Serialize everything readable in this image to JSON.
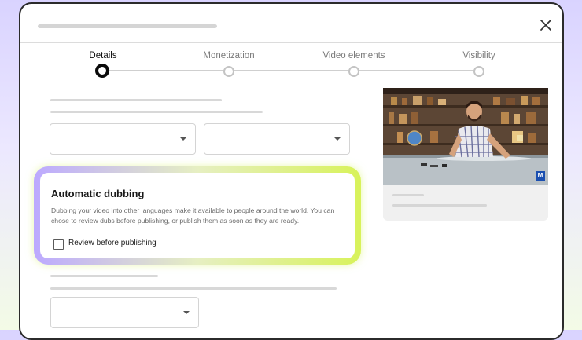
{
  "steps": [
    {
      "label": "Details",
      "active": true
    },
    {
      "label": "Monetization",
      "active": false
    },
    {
      "label": "Video elements",
      "active": false
    },
    {
      "label": "Visibility",
      "active": false
    }
  ],
  "dubbing": {
    "title": "Automatic dubbing",
    "description": "Dubbing your video into other languages make it available to people around the world. You can chose to review dubs before publishing, or publish them as soon as they are ready.",
    "checkbox_label": "Review before publishing",
    "checkbox_checked": false
  },
  "video_badge": "M",
  "icons": {
    "close": "close-icon",
    "dropdown": "chevron-down-icon",
    "badge": "monogram-badge-icon"
  },
  "colors": {
    "accent_purple": "#bca9ff",
    "accent_lime": "#d8f25a",
    "active_step": "#0a0a0a"
  }
}
